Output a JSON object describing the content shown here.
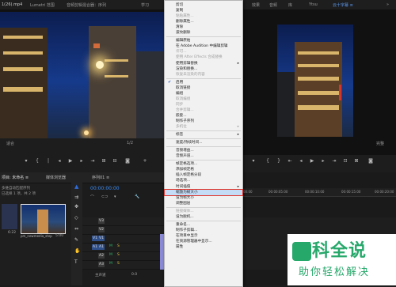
{
  "topbar": {
    "left_tab": "1(26).mp4",
    "tab_lumetri": "Lumetri 范围",
    "tab_program": "音频剪辑混合器：序列",
    "ws_learn": "学习",
    "ws_assembly": "组件",
    "ws_edit": "编辑",
    "ws_color": "颜色",
    "ws_effects": "效果",
    "ws_audio": "音频",
    "ws_titles": "图形",
    "ws_libraries": "库",
    "ws_more": "更多",
    "ws_custom": "Ytsu",
    "ws_active": "云十字幕 ≡"
  },
  "source_viewer": {
    "zoom_label": "适合",
    "fraction": "1/2",
    "timecode": "00:00:00"
  },
  "program_viewer": {
    "zoom_label": "完整"
  },
  "project_panel": {
    "title": "项目: 未命名  ≡",
    "tab_media": "媒体浏览器",
    "subtitle": "多维自动匹配序列",
    "path": "已选择 1 项，共 2 项",
    "clip1_name": "1(26).mp4",
    "clip1_dur": "6:22",
    "clip2_name": "pm_newmedia_step1.mp4",
    "clip2_dur": "5:00"
  },
  "timeline": {
    "title": "序列01  ≡",
    "timecode": "00:00:00:00",
    "ruler": [
      "00:00",
      "00:00:05:00",
      "00:00:10:00",
      "00:00:15:00",
      "00:00:20:00"
    ],
    "tracks_v": [
      "V3",
      "V2",
      "V1"
    ],
    "tracks_a": [
      "A1",
      "A2",
      "A3"
    ],
    "master": "主声道",
    "master_val": "0.0"
  },
  "context_menu": {
    "items": [
      {
        "label": "剪切",
        "enabled": true
      },
      {
        "label": "复制",
        "enabled": true
      },
      {
        "label": "粘贴属性...",
        "enabled": false
      },
      {
        "label": "删除属性...",
        "enabled": true
      },
      {
        "label": "清除",
        "enabled": true
      },
      {
        "label": "波纹删除",
        "enabled": true
      },
      {
        "sep": true
      },
      {
        "label": "编辑原始",
        "enabled": true
      },
      {
        "label": "在 Adobe Audition 中编辑剪辑",
        "enabled": true
      },
      {
        "label": "许可...",
        "enabled": false
      },
      {
        "label": "使用 After Effects 合成替换",
        "enabled": false
      },
      {
        "label": "使用剪辑替换",
        "enabled": true,
        "submenu": true
      },
      {
        "label": "渲染和替换...",
        "enabled": true
      },
      {
        "label": "恢复未渲染的内容",
        "enabled": false
      },
      {
        "sep": true
      },
      {
        "label": "启用",
        "enabled": true,
        "checked": true
      },
      {
        "label": "取消链接",
        "enabled": true
      },
      {
        "label": "编组",
        "enabled": true
      },
      {
        "label": "取消编组",
        "enabled": false
      },
      {
        "label": "同步",
        "enabled": false
      },
      {
        "label": "合并剪辑...",
        "enabled": false
      },
      {
        "label": "嵌套...",
        "enabled": true
      },
      {
        "label": "制作子序列",
        "enabled": true
      },
      {
        "label": "多机位",
        "enabled": false,
        "submenu": true
      },
      {
        "sep": true
      },
      {
        "label": "标签",
        "enabled": true,
        "submenu": true
      },
      {
        "sep": true
      },
      {
        "label": "速度/持续时间...",
        "enabled": true
      },
      {
        "sep": true
      },
      {
        "label": "音频增益...",
        "enabled": true
      },
      {
        "label": "音频声道...",
        "enabled": true
      },
      {
        "sep": true
      },
      {
        "label": "帧定格选项...",
        "enabled": true
      },
      {
        "label": "添加帧定格",
        "enabled": true
      },
      {
        "label": "插入帧定格分段",
        "enabled": true
      },
      {
        "label": "场选项...",
        "enabled": true
      },
      {
        "label": "时间插值",
        "enabled": true,
        "submenu": true
      },
      {
        "label": "缩放为帧大小",
        "enabled": true,
        "highlighted": true
      },
      {
        "label": "设为帧大小",
        "enabled": true
      },
      {
        "label": "调整图层",
        "enabled": true
      },
      {
        "sep": true
      },
      {
        "label": "链接媒体...",
        "enabled": false
      },
      {
        "label": "设为脱机...",
        "enabled": true
      },
      {
        "sep": true
      },
      {
        "label": "重命名...",
        "enabled": true
      },
      {
        "label": "制作子剪辑...",
        "enabled": true
      },
      {
        "label": "在项目中显示",
        "enabled": true
      },
      {
        "label": "在资源管理器中显示...",
        "enabled": true
      },
      {
        "label": "属性",
        "enabled": true
      }
    ]
  },
  "watermark": {
    "title": "百科全说",
    "subtitle": "助你轻松解决"
  },
  "colors": {
    "menu_bg": "#f1f1f1",
    "highlight": "#c4dcf6",
    "annotation_red": "#e0352a",
    "accent_blue": "#2f6bd8",
    "wm_green": "#27a86b"
  }
}
